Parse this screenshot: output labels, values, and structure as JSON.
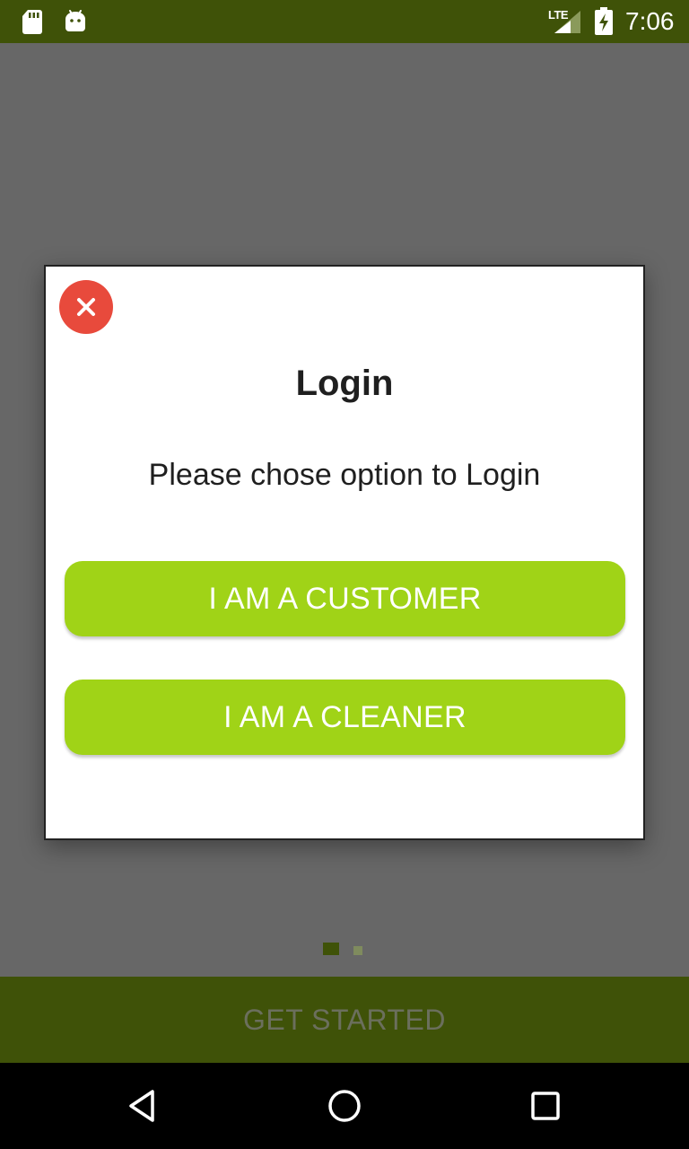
{
  "status_bar": {
    "network_type": "LTE",
    "time": "7:06",
    "icons": [
      "sd-card-icon",
      "android-icon",
      "signal-icon",
      "battery-charging-icon"
    ]
  },
  "background": {
    "pager_dots": {
      "count": 2,
      "active_index": 0
    },
    "get_started_label": "GET STARTED"
  },
  "dialog": {
    "close_icon": "close-icon",
    "title": "Login",
    "message": "Please chose option to Login",
    "buttons": {
      "customer": "I AM A CUSTOMER",
      "cleaner": "I AM A CLEANER"
    }
  },
  "nav_bar": {
    "icons": [
      "back-icon",
      "home-icon",
      "recents-icon"
    ]
  },
  "colors": {
    "status_bar": "#3f5208",
    "scrim": "#676767",
    "button_green": "#a0d317",
    "close_red": "#e84a3c",
    "nav_bar": "#000000"
  }
}
